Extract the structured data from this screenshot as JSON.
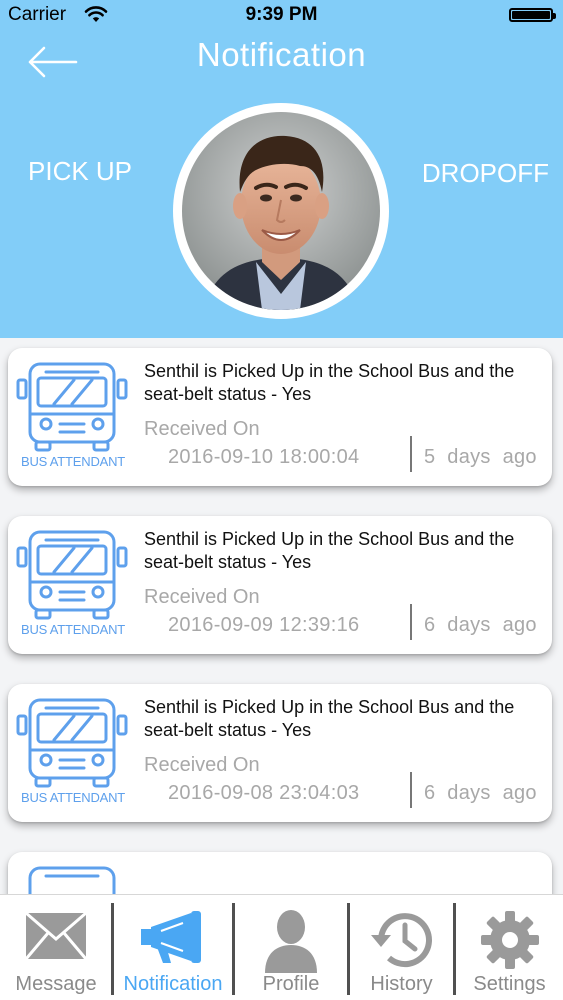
{
  "status_bar": {
    "carrier": "Carrier",
    "time": "9:39 PM"
  },
  "header": {
    "title": "Notification",
    "pickup_label": "PICK UP",
    "dropoff_label": "DROPOFF"
  },
  "notifications": [
    {
      "sender_label": "BUS ATTENDANT",
      "message": "Senthil is Picked Up in the School Bus and the seat-belt status - Yes",
      "received_label": "Received On",
      "received_at": "2016-09-10 18:00:04",
      "ago": "5 days ago"
    },
    {
      "sender_label": "BUS ATTENDANT",
      "message": "Senthil is Picked Up in the School Bus and the seat-belt status - Yes",
      "received_label": "Received On",
      "received_at": "2016-09-09 12:39:16",
      "ago": "6 days ago"
    },
    {
      "sender_label": "BUS ATTENDANT",
      "message": "Senthil is Picked Up in the School Bus and the seat-belt status - Yes",
      "received_label": "Received On",
      "received_at": "2016-09-08 23:04:03",
      "ago": "6 days ago"
    }
  ],
  "tabs": [
    {
      "label": "Message",
      "icon": "envelope-icon"
    },
    {
      "label": "Notification",
      "icon": "megaphone-icon",
      "active": true
    },
    {
      "label": "Profile",
      "icon": "person-icon"
    },
    {
      "label": "History",
      "icon": "history-icon"
    },
    {
      "label": "Settings",
      "icon": "gear-icon"
    }
  ],
  "colors": {
    "header": "#82cdf8",
    "accent": "#4aa7f3",
    "bus_icon": "#5ea0ec",
    "muted_text": "#a8a8a8"
  }
}
